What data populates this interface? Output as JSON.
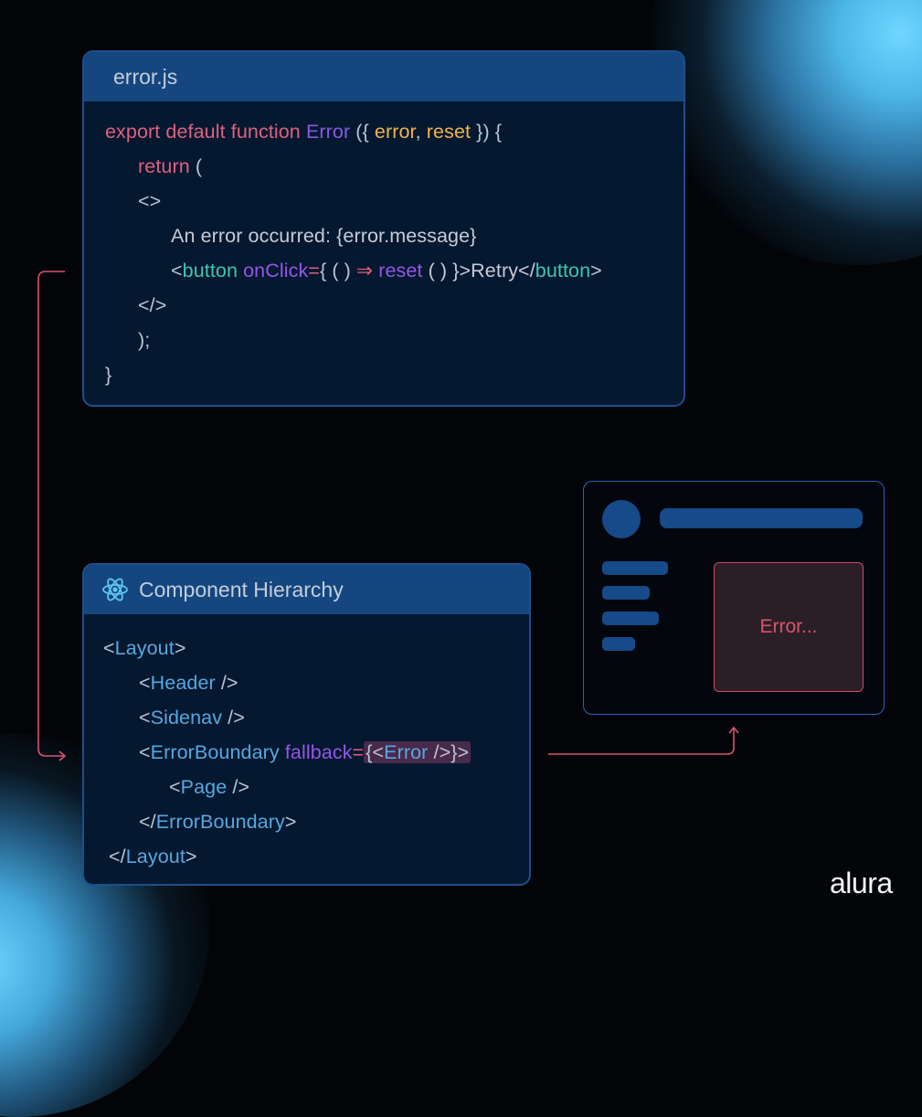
{
  "error_panel": {
    "filename": "error.js",
    "lines": {
      "l1": {
        "kw": "export default function ",
        "fn": "Error ",
        "p1": "({ ",
        "a1": "error",
        ",": ", ",
        "a2": "reset",
        " p2": " }) {"
      },
      "l2": {
        "kw": "return ",
        "p": "("
      },
      "l3": {
        "p": "<>"
      },
      "l4": {
        "text": "An error occurred: {error.message}"
      },
      "l5": {
        "lt": "<",
        "tag": "button ",
        "attr": "onClick",
        "eq": "=",
        "p1": "{ ( ) ",
        "arrow": "⇒ ",
        "fn": "reset ",
        "p2": "( ) }>Retry</",
        "tag2": "button",
        ">": ">"
      },
      "l6": {
        "p": "</>"
      },
      "l7": {
        "p": ");"
      },
      "l8": {
        "p": "}"
      }
    }
  },
  "hierarchy_panel": {
    "icon": "react-icon",
    "title": "Component Hierarchy",
    "lines": {
      "layout_open": {
        "lt": "<",
        "name": "Layout",
        "gt": ">"
      },
      "header": {
        "lt": "<",
        "name": "Header",
        "gt": " />"
      },
      "sidenav": {
        "lt": "<",
        "name": "Sidenav",
        "gt": " />"
      },
      "boundary_open": {
        "lt": "<",
        "name": "ErrorBoundary ",
        "attr": "fallback",
        "eq": "=",
        "hl_open": "{<",
        "hl_name": "Error",
        "hl_close": " />}>"
      },
      "page": {
        "lt": "<",
        "name": "Page",
        "gt": " />"
      },
      "boundary_close": {
        "lt": "</",
        "name": "ErrorBoundary",
        "gt": ">"
      },
      "layout_close": {
        "lt": "</",
        "name": "Layout",
        "gt": ">"
      }
    }
  },
  "mockup": {
    "error_text": "Error..."
  },
  "brand": {
    "logo_text": "alura"
  },
  "colors": {
    "keyword": "#e0607e",
    "function": "#8a5ae0",
    "param": "#f1b44c",
    "tag": "#3fc6b2",
    "component": "#56a8e0",
    "panel_header": "#15467f",
    "panel_body": "#041830",
    "error_accent": "#cf4a63"
  }
}
